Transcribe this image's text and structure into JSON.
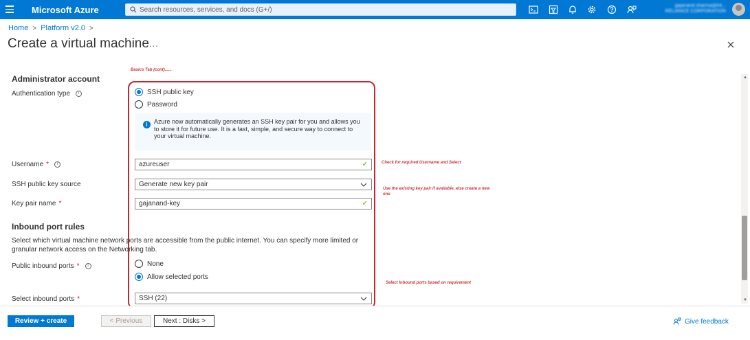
{
  "topbar": {
    "brand": "Microsoft Azure",
    "search_placeholder": "Search resources, services, and docs (G+/)",
    "icons": [
      "cloud-shell-icon",
      "directory-filter-icon",
      "notifications-bell-icon",
      "settings-gear-icon",
      "help-question-icon",
      "feedback-person-icon"
    ],
    "user_lines": [
      "gajanand.sharma@lnt...",
      "RELIANCE CORPORATION"
    ]
  },
  "breadcrumb": {
    "home": "Home",
    "platform": "Platform v2.0",
    "separator": ">"
  },
  "page": {
    "title": "Create a virtual machine",
    "more": "..."
  },
  "admin": {
    "heading": "Administrator account",
    "auth_label": "Authentication type",
    "auth_options": [
      "SSH public key",
      "Password"
    ],
    "auth_selected": "SSH public key",
    "info_text": "Azure now automatically generates an SSH key pair for you and allows you to store it for future use. It is a fast, simple, and secure way to connect to your virtual machine.",
    "username_label": "Username",
    "username_value": "azureuser",
    "ssh_source_label": "SSH public key source",
    "ssh_source_value": "Generate new key pair",
    "keypair_label": "Key pair name",
    "keypair_value": "gajanand-key",
    "required_mark": "*"
  },
  "inbound": {
    "heading": "Inbound port rules",
    "description": "Select which virtual machine network ports are accessible from the public internet. You can specify more limited or granular network access on the Networking tab.",
    "public_ports_label": "Public inbound ports",
    "port_options": [
      "None",
      "Allow selected ports"
    ],
    "port_selected": "Allow selected ports",
    "select_ports_label": "Select inbound ports",
    "select_ports_value": "SSH (22)"
  },
  "annotations": {
    "basics": "Basics Tab (cont)......",
    "username_note": "Check for required Username and Select",
    "keypair_note": "Use the existing key pair if available, else create a new one",
    "ports_note": "Select Inbound ports based on requirement"
  },
  "footer": {
    "review": "Review + create",
    "previous": "< Previous",
    "next": "Next : Disks >",
    "feedback": "Give feedback"
  },
  "colors": {
    "azure_blue": "#0078d4",
    "annotation_red": "#c4262e",
    "valid_green": "#57a300"
  }
}
